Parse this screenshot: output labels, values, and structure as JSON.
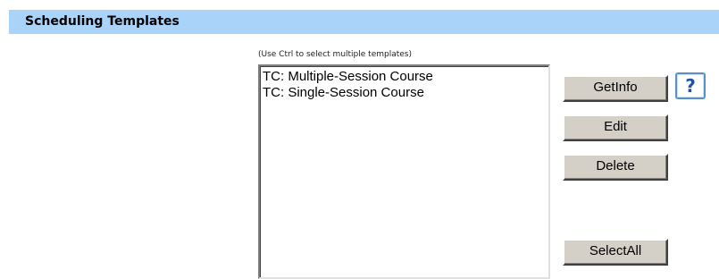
{
  "header": {
    "title": "Scheduling Templates"
  },
  "templates": {
    "hint": "(Use Ctrl to select multiple templates)",
    "items": [
      "TC: Multiple-Session Course",
      "TC: Single-Session Course"
    ]
  },
  "actions": {
    "getinfo_label": "GetInfo",
    "help_label": "?",
    "help_icon": "question-mark-icon",
    "edit_label": "Edit",
    "delete_label": "Delete",
    "selectall_label": "SelectAll"
  },
  "colors": {
    "header_background": "#a9d3f9",
    "button_face": "#d4d0c8",
    "help_accent": "#1f4fa8"
  }
}
